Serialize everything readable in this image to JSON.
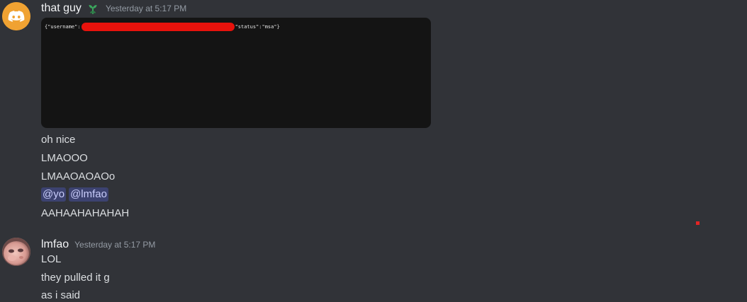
{
  "messages": [
    {
      "author": "that guy",
      "timestamp": "Yesterday at 5:17 PM",
      "avatar_icon": "discord-logo-icon",
      "role_icon": "sprout-icon",
      "embed": {
        "code_prefix": "{\"username\":",
        "code_suffix": "\"status\":\"msa\"}",
        "redaction_color": "#e8120c"
      },
      "lines": [
        "oh nice",
        "LMAOOO",
        "LMAAOAOAOo"
      ],
      "mentions": [
        "@yo",
        "@lmfao"
      ],
      "last_line": "AAHAAHAHAHAH"
    },
    {
      "author": "lmfao",
      "timestamp": "Yesterday at 5:17 PM",
      "avatar_icon": "user-photo-avatar",
      "lines": [
        "LOL",
        "they pulled it g",
        "as i said"
      ]
    }
  ],
  "colors": {
    "background": "#313338",
    "mention_bg": "#3c4270",
    "mention_text": "#c9cdfb",
    "avatar_discord": "#f0a232"
  }
}
